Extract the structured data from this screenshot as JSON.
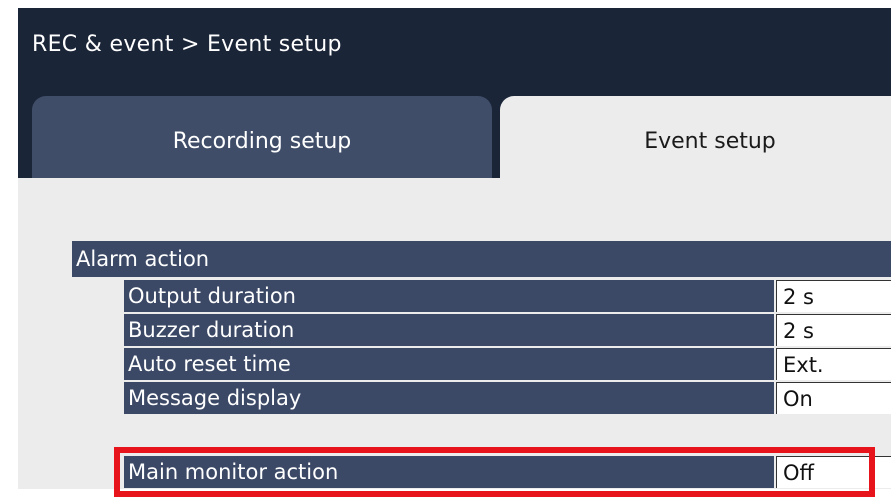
{
  "breadcrumb": "REC & event > Event setup",
  "tabs": [
    {
      "label": "Recording setup",
      "active": false
    },
    {
      "label": "Event setup",
      "active": true
    }
  ],
  "section": {
    "title": "Alarm action",
    "rows": [
      {
        "label": "Output duration",
        "value": "2 s"
      },
      {
        "label": "Buzzer duration",
        "value": "2 s"
      },
      {
        "label": "Auto reset time",
        "value": "Ext."
      },
      {
        "label": "Message display",
        "value": "On"
      },
      {
        "label": "Main monitor action",
        "value": "Off"
      }
    ]
  },
  "highlight_color": "#e8141c"
}
